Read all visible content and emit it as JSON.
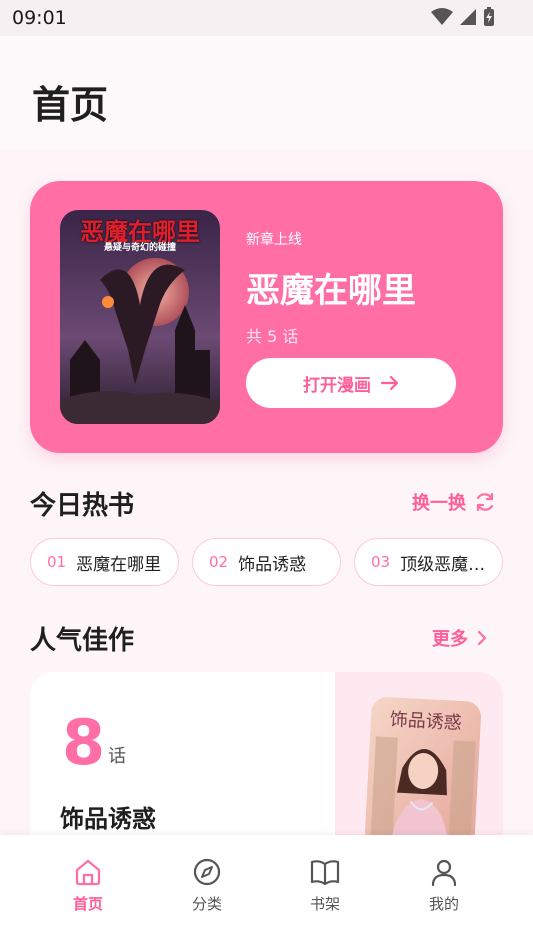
{
  "status_bar": {
    "time": "09:01"
  },
  "header": {
    "title": "首页"
  },
  "hero": {
    "tag": "新章上线",
    "title": "恶魔在哪里",
    "count": "共 5 话",
    "open_button": "打开漫画",
    "cover": {
      "title": "恶魔在哪里",
      "subtitle": "悬疑与奇幻的碰撞"
    }
  },
  "today": {
    "title": "今日热书",
    "refresh": "换一换",
    "items": [
      {
        "num": "01",
        "name": "恶魔在哪里"
      },
      {
        "num": "02",
        "name": "饰品诱惑"
      },
      {
        "num": "03",
        "name": "顶级恶魔…"
      }
    ]
  },
  "popular": {
    "title": "人气佳作",
    "more": "更多",
    "card": {
      "count": "8",
      "unit": "话",
      "name": "饰品诱惑",
      "cover_text": "饰品诱惑"
    }
  },
  "tabs": [
    {
      "label": "首页",
      "icon": "home-icon",
      "active": true
    },
    {
      "label": "分类",
      "icon": "compass-icon",
      "active": false
    },
    {
      "label": "书架",
      "icon": "book-icon",
      "active": false
    },
    {
      "label": "我的",
      "icon": "user-icon",
      "active": false
    }
  ],
  "colors": {
    "accent": "#ff6fa6",
    "accent_dark": "#ff5e99"
  }
}
